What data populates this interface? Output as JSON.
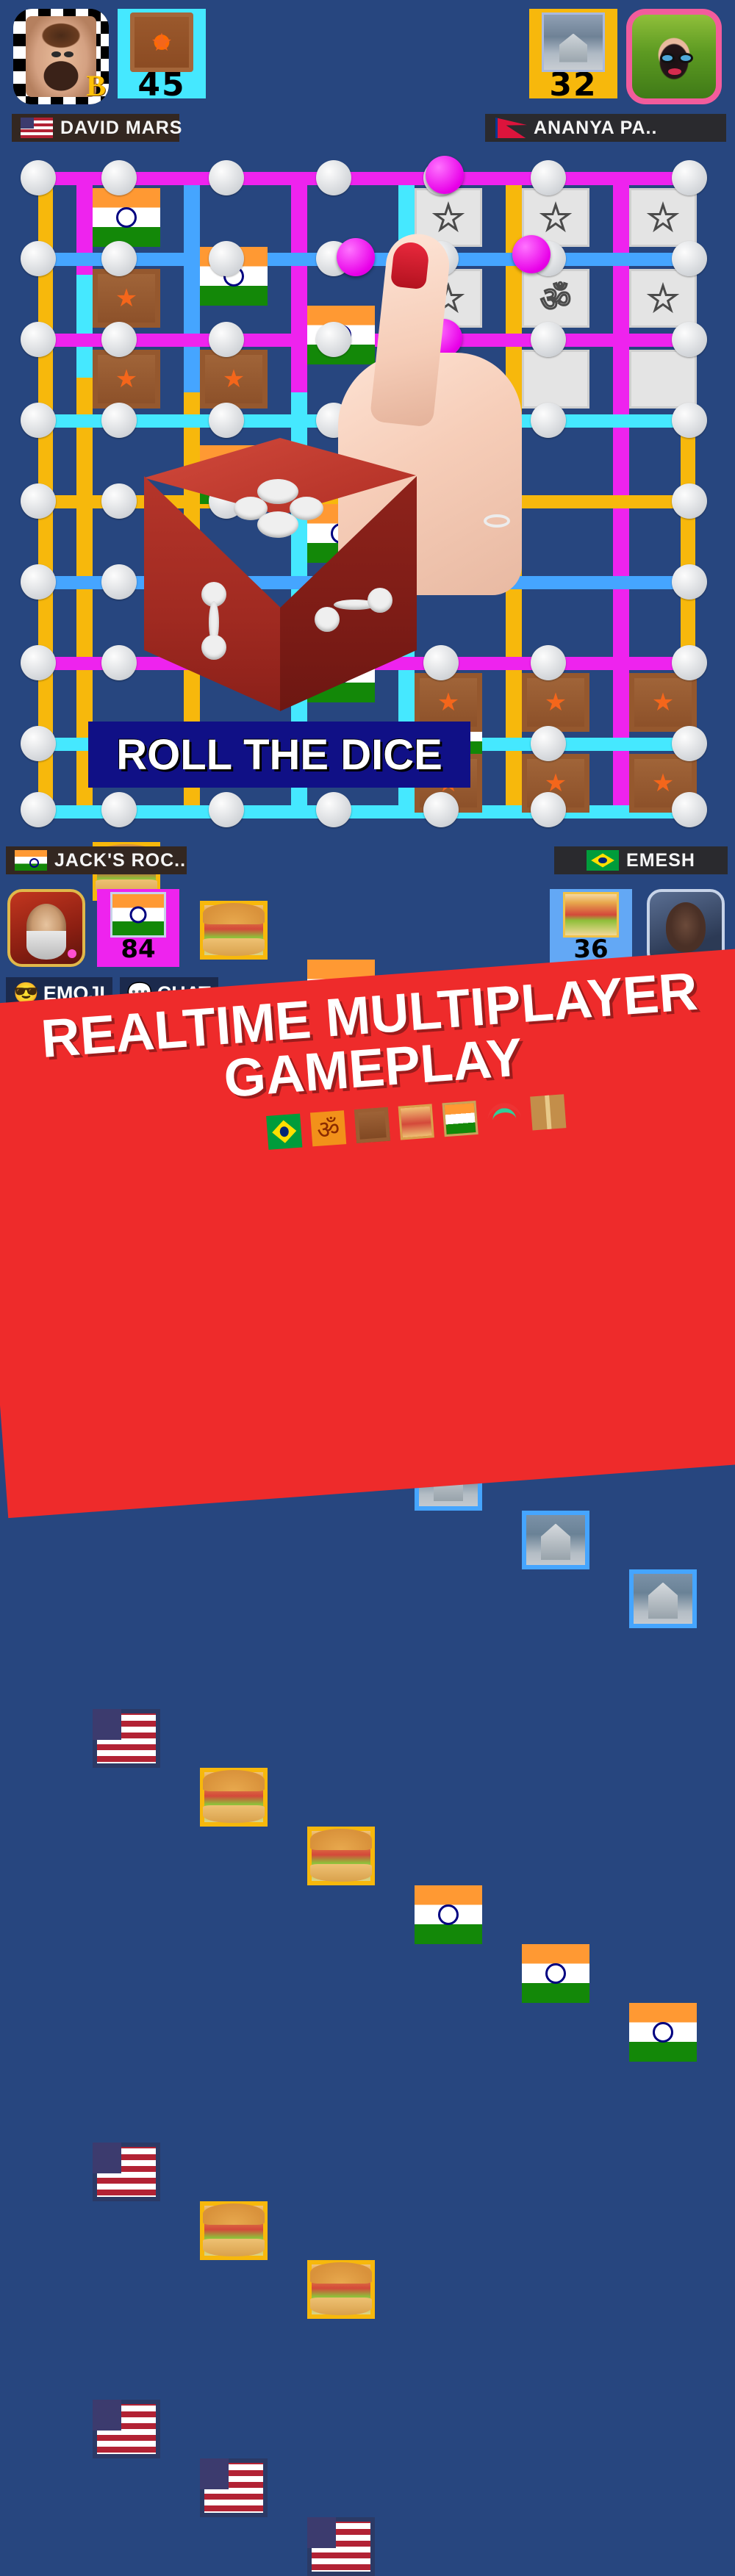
{
  "app": {
    "background_color": "#27467f",
    "board_color": "#27467f"
  },
  "players": {
    "top_left": {
      "name": "DAVID MARS",
      "flag": "us-flag-icon",
      "score": "45",
      "score_tile_color": "#45e8ff",
      "avatar": "astronaut-man-avatar",
      "avatar_badge": "B"
    },
    "top_right": {
      "name": "ANANYA PA..",
      "flag": "nepal-flag-icon",
      "score": "32",
      "score_tile_color": "#f7b80c",
      "avatar": "indian-bride-avatar"
    },
    "bottom_left": {
      "name": "JACK'S ROC..",
      "flag": "india-flag-icon",
      "score": "84",
      "score_tile_color": "#ee23ee",
      "avatar": "sage-warrior-avatar"
    },
    "bottom_right": {
      "name": "EMESH",
      "flag": "brazil-flag-icon",
      "score": "36",
      "score_tile_color": "#63a8f5",
      "avatar": "man-portrait-avatar"
    }
  },
  "board": {
    "rows": 8,
    "cols": 6,
    "tiles": [
      {
        "type": "india-flag-tile"
      },
      {
        "type": "india-flag-tile"
      },
      {
        "type": "india-flag-tile"
      },
      {
        "type": "star-tile"
      },
      {
        "type": "star-tile"
      },
      {
        "type": "star-tile"
      },
      {
        "type": "chocolate-tile"
      },
      {
        "type": "india-flag-tile"
      },
      {
        "type": "india-flag-tile"
      },
      {
        "type": "star-tile"
      },
      {
        "type": "star-tile"
      },
      {
        "type": "star-tile"
      },
      {
        "type": "chocolate-tile"
      },
      {
        "type": "chocolate-tile"
      },
      {
        "type": "india-flag-tile"
      },
      {
        "type": "india-flag-tile"
      },
      {
        "type": "temple-tile"
      },
      {
        "type": "temple-tile"
      },
      {
        "type": "burger-tile"
      },
      {
        "type": "burger-tile"
      },
      {
        "type": "india-flag-tile"
      },
      {
        "type": "india-flag-tile"
      },
      {
        "type": "temple-tile"
      },
      {
        "type": "temple-tile"
      },
      {
        "type": "burger-tile"
      },
      {
        "type": "burger-tile"
      },
      {
        "type": "burger-tile"
      },
      {
        "type": "temple-tile"
      },
      {
        "type": "temple-tile"
      },
      {
        "type": "temple-tile"
      },
      {
        "type": "us-flag-tile"
      },
      {
        "type": "burger-tile"
      },
      {
        "type": "burger-tile"
      },
      {
        "type": "india-flag-tile"
      },
      {
        "type": "india-flag-tile"
      },
      {
        "type": "india-flag-tile"
      },
      {
        "type": "us-flag-tile"
      },
      {
        "type": "burger-tile"
      },
      {
        "type": "burger-tile"
      },
      {
        "type": "chocolate-tile"
      },
      {
        "type": "chocolate-tile"
      },
      {
        "type": "chocolate-tile"
      },
      {
        "type": "us-flag-tile"
      },
      {
        "type": "us-flag-tile"
      },
      {
        "type": "us-flag-tile"
      },
      {
        "type": "chocolate-tile"
      },
      {
        "type": "chocolate-tile"
      },
      {
        "type": "chocolate-tile"
      }
    ],
    "token_color": "#e800e8",
    "peg_color": "#d2d5d9"
  },
  "dice": {
    "color": "#b5352a",
    "top_face_value": "4",
    "left_face_value": "2",
    "right_face_value": "2"
  },
  "buttons": {
    "roll": "ROLL THE DICE",
    "roll_bg": "#101086",
    "emoji": "EMOJI",
    "emoji_icon": "smiling-face-sunglasses-icon",
    "chat": "CHAT",
    "chat_icon": "speech-bubble-icon"
  },
  "promo": {
    "line1": "REALTIME MULTIPLAYER",
    "line2": "GAMEPLAY",
    "bg_color": "#ee2b2b",
    "icons": [
      "brazil-flag-icon",
      "om-symbol-icon",
      "chocolate-icon",
      "burger-icon",
      "india-flag-icon",
      "rainbow-icon",
      "gift-icon"
    ]
  }
}
